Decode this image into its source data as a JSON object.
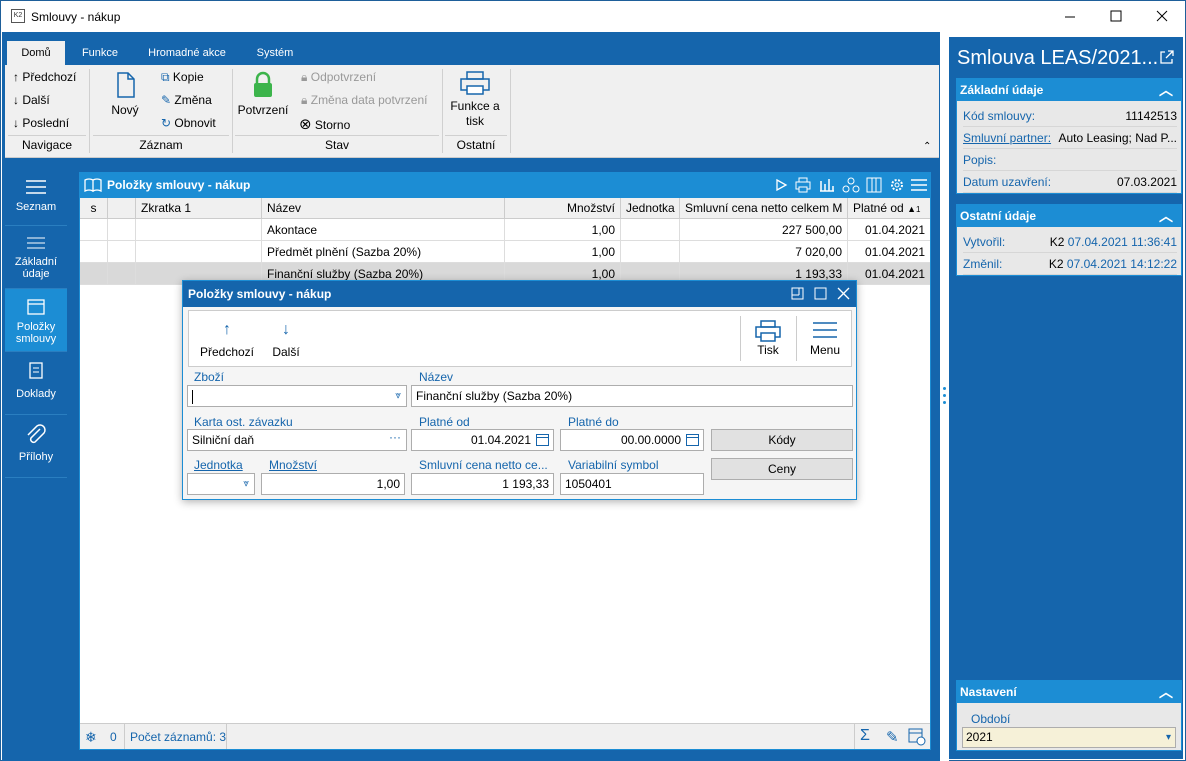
{
  "window": {
    "title": "Smlouvy - nákup",
    "app_icon": "K2"
  },
  "ribbon": {
    "tabs": [
      "Domů",
      "Funkce",
      "Hromadné akce",
      "Systém"
    ],
    "navigace": {
      "prev": "Předchozí",
      "next": "Další",
      "last": "Poslední",
      "group": "Navigace"
    },
    "zaznam": {
      "new": "Nový",
      "copy": "Kopie",
      "change": "Změna",
      "refresh": "Obnovit",
      "group": "Záznam"
    },
    "stav": {
      "confirm": "Potvrzení",
      "unconfirm": "Odpotvrzení",
      "change_date": "Změna data potvrzení",
      "cancel": "Storno",
      "group": "Stav"
    },
    "ostatni": {
      "functions_l1": "Funkce a",
      "functions_l2": "tisk",
      "group": "Ostatní"
    }
  },
  "sidebar": {
    "items": [
      {
        "label1": "Seznam",
        "label2": ""
      },
      {
        "label1": "Základní",
        "label2": "údaje"
      },
      {
        "label1": "Položky",
        "label2": "smlouvy"
      },
      {
        "label1": "Doklady",
        "label2": ""
      },
      {
        "label1": "Přílohy",
        "label2": ""
      }
    ]
  },
  "grid": {
    "title": "Položky smlouvy - nákup",
    "columns": [
      "s",
      "Zkratka 1",
      "Název",
      "Množství",
      "Jednotka",
      "Smluvní cena netto celkem M",
      "Platné od"
    ],
    "sort_indicator": "1",
    "rows": [
      {
        "nazev": "Akontace",
        "mnozstvi": "1,00",
        "cena": "227 500,00",
        "platne": "01.04.2021"
      },
      {
        "nazev": "Předmět plnění (Sazba 20%)",
        "mnozstvi": "1,00",
        "cena": "7 020,00",
        "platne": "01.04.2021"
      },
      {
        "nazev": "Finanční služby (Sazba 20%)",
        "mnozstvi": "1,00",
        "cena": "1 193,33",
        "platne": "01.04.2021"
      }
    ],
    "footer": {
      "count_num": "0",
      "records": "Počet záznamů: 3"
    }
  },
  "dialog": {
    "title": "Položky smlouvy - nákup",
    "toolbar": {
      "prev": "Předchozí",
      "next": "Další",
      "print": "Tisk",
      "menu": "Menu"
    },
    "fields": {
      "zbozi_label": "Zboží",
      "zbozi": "",
      "nazev_label": "Název",
      "nazev": "Finanční služby (Sazba 20%)",
      "karta_label": "Karta ost. závazku",
      "karta": "Silniční daň",
      "platne_od_label": "Platné od",
      "platne_od": "01.04.2021",
      "platne_do_label": "Platné do",
      "platne_do": "00.00.0000",
      "jednotka_label": "Jednotka",
      "jednotka": "",
      "mnozstvi_label": "Množství",
      "mnozstvi": "1,00",
      "cena_label": "Smluvní cena netto ce...",
      "cena": "1 193,33",
      "vs_label": "Variabilní symbol",
      "vs": "1050401"
    },
    "buttons": {
      "kody": "Kódy",
      "ceny": "Ceny"
    }
  },
  "right_panel": {
    "title": "Smlouva LEAS/2021...",
    "basic": {
      "header": "Základní údaje",
      "rows": [
        {
          "label": "Kód smlouvy:",
          "value": "11142513"
        },
        {
          "label": "Smluvní partner:",
          "value": "Auto Leasing; Nad P..."
        },
        {
          "label": "Popis:",
          "value": ""
        },
        {
          "label": "Datum uzavření:",
          "value": "07.03.2021"
        }
      ]
    },
    "other": {
      "header": "Ostatní údaje",
      "rows": [
        {
          "label": "Vytvořil:",
          "user": "K2",
          "value": "07.04.2021 11:36:41"
        },
        {
          "label": "Změnil:",
          "user": "K2",
          "value": "07.04.2021 14:12:22"
        }
      ]
    },
    "settings": {
      "header": "Nastavení",
      "obdobi_label": "Období",
      "obdobi": "2021"
    }
  },
  "colors": {
    "primary": "#1565ac",
    "accent": "#1c8dd4",
    "ribbon": "#f0f0f0"
  }
}
